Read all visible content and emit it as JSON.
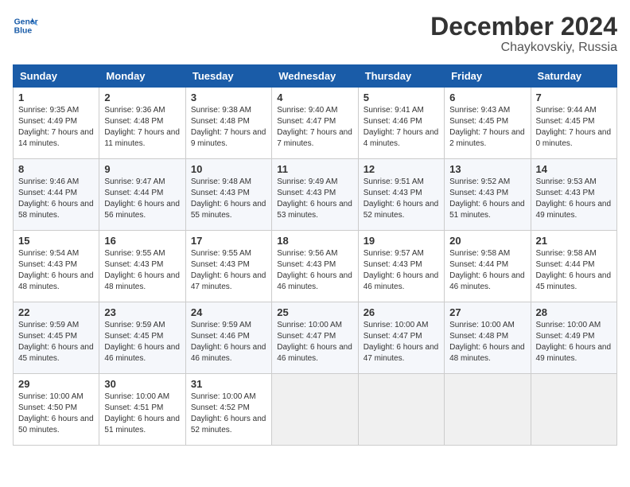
{
  "header": {
    "logo_line1": "General",
    "logo_line2": "Blue",
    "month": "December 2024",
    "location": "Chaykovskiy, Russia"
  },
  "days_of_week": [
    "Sunday",
    "Monday",
    "Tuesday",
    "Wednesday",
    "Thursday",
    "Friday",
    "Saturday"
  ],
  "weeks": [
    [
      {
        "day": "1",
        "info": "Sunrise: 9:35 AM\nSunset: 4:49 PM\nDaylight: 7 hours and 14 minutes."
      },
      {
        "day": "2",
        "info": "Sunrise: 9:36 AM\nSunset: 4:48 PM\nDaylight: 7 hours and 11 minutes."
      },
      {
        "day": "3",
        "info": "Sunrise: 9:38 AM\nSunset: 4:48 PM\nDaylight: 7 hours and 9 minutes."
      },
      {
        "day": "4",
        "info": "Sunrise: 9:40 AM\nSunset: 4:47 PM\nDaylight: 7 hours and 7 minutes."
      },
      {
        "day": "5",
        "info": "Sunrise: 9:41 AM\nSunset: 4:46 PM\nDaylight: 7 hours and 4 minutes."
      },
      {
        "day": "6",
        "info": "Sunrise: 9:43 AM\nSunset: 4:45 PM\nDaylight: 7 hours and 2 minutes."
      },
      {
        "day": "7",
        "info": "Sunrise: 9:44 AM\nSunset: 4:45 PM\nDaylight: 7 hours and 0 minutes."
      }
    ],
    [
      {
        "day": "8",
        "info": "Sunrise: 9:46 AM\nSunset: 4:44 PM\nDaylight: 6 hours and 58 minutes."
      },
      {
        "day": "9",
        "info": "Sunrise: 9:47 AM\nSunset: 4:44 PM\nDaylight: 6 hours and 56 minutes."
      },
      {
        "day": "10",
        "info": "Sunrise: 9:48 AM\nSunset: 4:43 PM\nDaylight: 6 hours and 55 minutes."
      },
      {
        "day": "11",
        "info": "Sunrise: 9:49 AM\nSunset: 4:43 PM\nDaylight: 6 hours and 53 minutes."
      },
      {
        "day": "12",
        "info": "Sunrise: 9:51 AM\nSunset: 4:43 PM\nDaylight: 6 hours and 52 minutes."
      },
      {
        "day": "13",
        "info": "Sunrise: 9:52 AM\nSunset: 4:43 PM\nDaylight: 6 hours and 51 minutes."
      },
      {
        "day": "14",
        "info": "Sunrise: 9:53 AM\nSunset: 4:43 PM\nDaylight: 6 hours and 49 minutes."
      }
    ],
    [
      {
        "day": "15",
        "info": "Sunrise: 9:54 AM\nSunset: 4:43 PM\nDaylight: 6 hours and 48 minutes."
      },
      {
        "day": "16",
        "info": "Sunrise: 9:55 AM\nSunset: 4:43 PM\nDaylight: 6 hours and 48 minutes."
      },
      {
        "day": "17",
        "info": "Sunrise: 9:55 AM\nSunset: 4:43 PM\nDaylight: 6 hours and 47 minutes."
      },
      {
        "day": "18",
        "info": "Sunrise: 9:56 AM\nSunset: 4:43 PM\nDaylight: 6 hours and 46 minutes."
      },
      {
        "day": "19",
        "info": "Sunrise: 9:57 AM\nSunset: 4:43 PM\nDaylight: 6 hours and 46 minutes."
      },
      {
        "day": "20",
        "info": "Sunrise: 9:58 AM\nSunset: 4:44 PM\nDaylight: 6 hours and 46 minutes."
      },
      {
        "day": "21",
        "info": "Sunrise: 9:58 AM\nSunset: 4:44 PM\nDaylight: 6 hours and 45 minutes."
      }
    ],
    [
      {
        "day": "22",
        "info": "Sunrise: 9:59 AM\nSunset: 4:45 PM\nDaylight: 6 hours and 45 minutes."
      },
      {
        "day": "23",
        "info": "Sunrise: 9:59 AM\nSunset: 4:45 PM\nDaylight: 6 hours and 46 minutes."
      },
      {
        "day": "24",
        "info": "Sunrise: 9:59 AM\nSunset: 4:46 PM\nDaylight: 6 hours and 46 minutes."
      },
      {
        "day": "25",
        "info": "Sunrise: 10:00 AM\nSunset: 4:47 PM\nDaylight: 6 hours and 46 minutes."
      },
      {
        "day": "26",
        "info": "Sunrise: 10:00 AM\nSunset: 4:47 PM\nDaylight: 6 hours and 47 minutes."
      },
      {
        "day": "27",
        "info": "Sunrise: 10:00 AM\nSunset: 4:48 PM\nDaylight: 6 hours and 48 minutes."
      },
      {
        "day": "28",
        "info": "Sunrise: 10:00 AM\nSunset: 4:49 PM\nDaylight: 6 hours and 49 minutes."
      }
    ],
    [
      {
        "day": "29",
        "info": "Sunrise: 10:00 AM\nSunset: 4:50 PM\nDaylight: 6 hours and 50 minutes."
      },
      {
        "day": "30",
        "info": "Sunrise: 10:00 AM\nSunset: 4:51 PM\nDaylight: 6 hours and 51 minutes."
      },
      {
        "day": "31",
        "info": "Sunrise: 10:00 AM\nSunset: 4:52 PM\nDaylight: 6 hours and 52 minutes."
      },
      null,
      null,
      null,
      null
    ]
  ]
}
